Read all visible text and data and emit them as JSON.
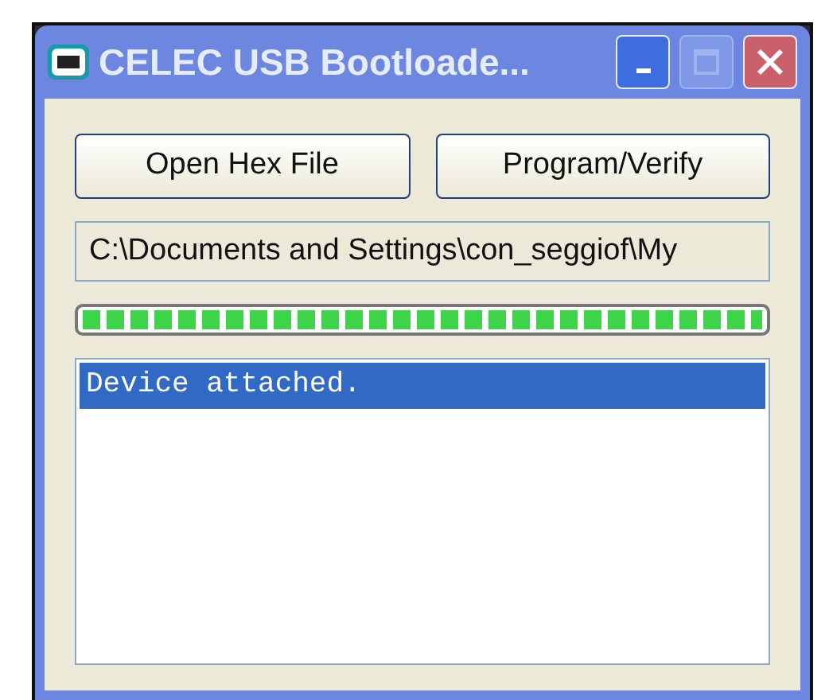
{
  "window": {
    "title": "CELEC USB Bootloade..."
  },
  "buttons": [
    "Open Hex File",
    "Program/Verify"
  ],
  "file_path": {
    "value": "C:\\Documents and Settings\\con_seggiof\\My"
  },
  "progress": {
    "level": 1
  },
  "log": [
    {
      "text": "Device attached.",
      "selected": true
    }
  ]
}
